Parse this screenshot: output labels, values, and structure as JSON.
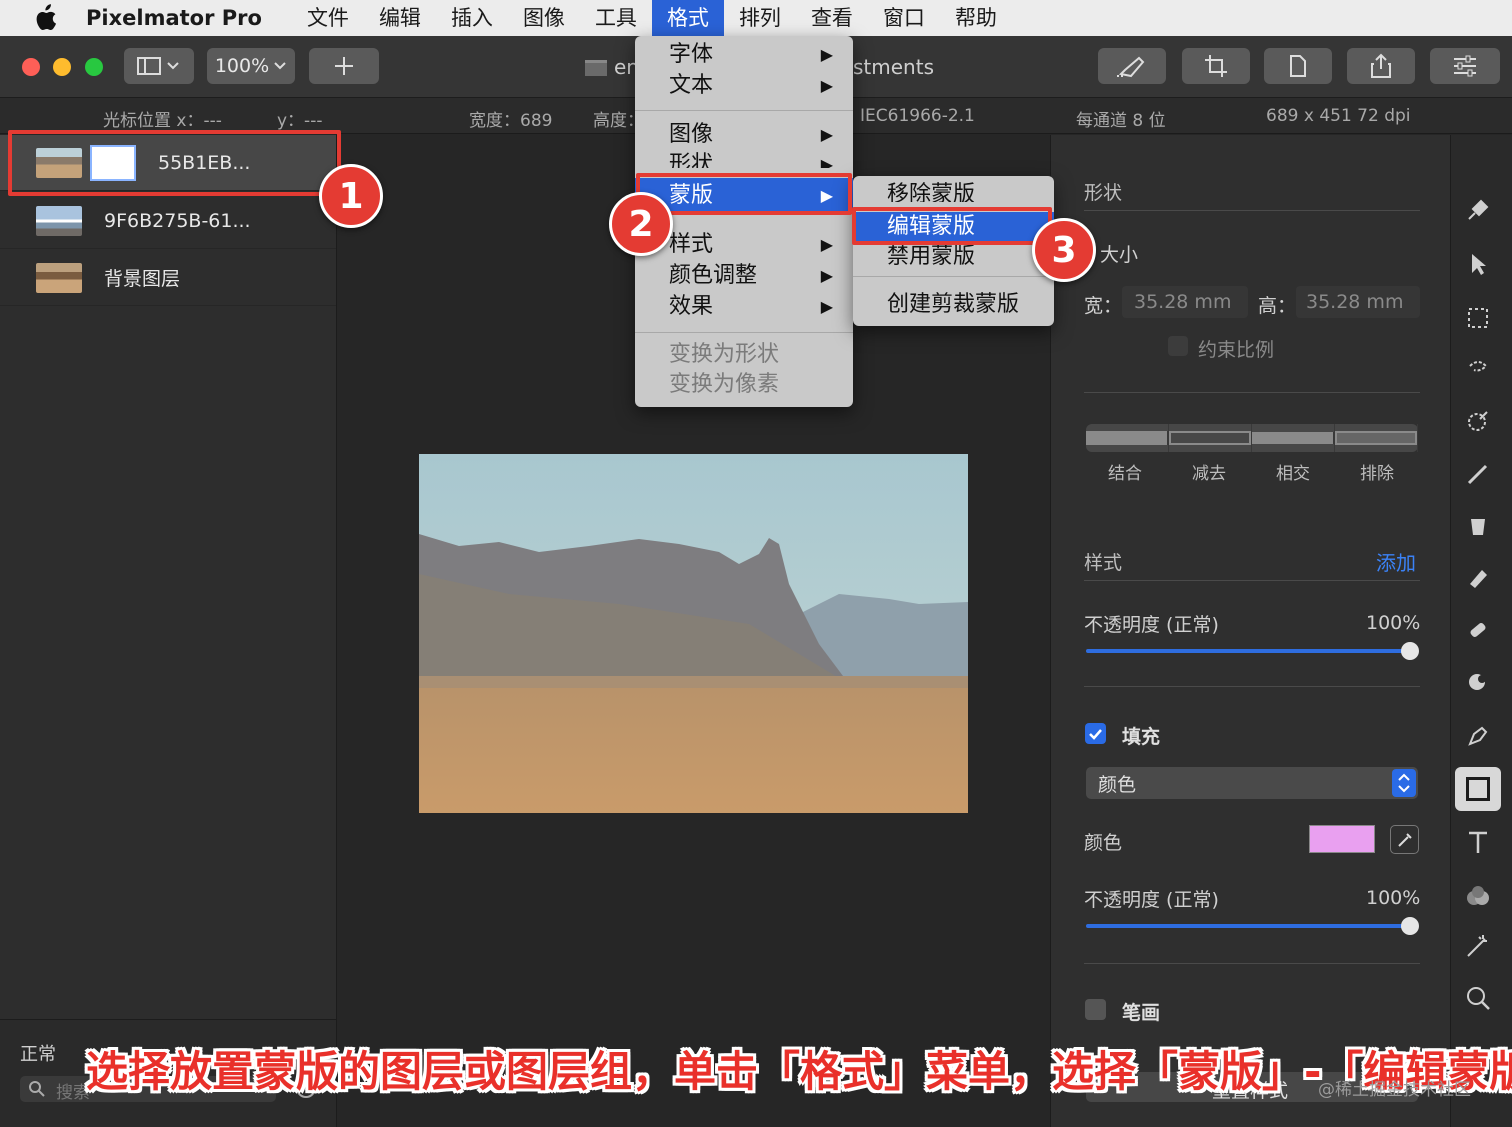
{
  "menubar": {
    "app_name": "Pixelmator Pro",
    "items": [
      "文件",
      "编辑",
      "插入",
      "图像",
      "工具",
      "格式",
      "排列",
      "查看",
      "窗口",
      "帮助"
    ],
    "active_index": 5
  },
  "toolbar": {
    "zoom": "100%",
    "doc_title_left": "en",
    "doc_title_right": "stments"
  },
  "infobar": {
    "cursor_x": "光标位置 x：---",
    "cursor_y": "y：---",
    "width": "宽度：689",
    "height": "高度：",
    "profile": "IEC61966-2.1",
    "depth": "每通道 8 位",
    "size": "689 x 451 72 dpi"
  },
  "layers": [
    {
      "name": "55B1EB...",
      "selected": true
    },
    {
      "name": "9F6B275B-61...",
      "selected": false
    },
    {
      "name": "背景图层",
      "selected": false
    }
  ],
  "layers_footer": {
    "blend_mode": "正常",
    "search_placeholder": "搜索"
  },
  "format_menu": {
    "items": [
      "字体",
      "文本",
      "图像",
      "形状",
      "蒙版",
      "样式",
      "颜色调整",
      "效果",
      "变换为形状",
      "变换为像素"
    ]
  },
  "mask_submenu": {
    "items": [
      "移除蒙版",
      "编辑蒙版",
      "禁用蒙版",
      "创建剪裁蒙版"
    ]
  },
  "inspector": {
    "shape_title": "形状",
    "size_label": "大小",
    "width_label": "宽：",
    "width_value": "35.28 mm",
    "height_label": "高：",
    "height_value": "35.28 mm",
    "constrain_label": "约束比例",
    "bool_ops": [
      "结合",
      "减去",
      "相交",
      "排除"
    ],
    "style_title": "样式",
    "add_label": "添加",
    "opacity_label": "不透明度 (正常)",
    "opacity_value": "100%",
    "fill_label": "填充",
    "fill_type": "颜色",
    "color_label": "颜色",
    "fill_color": "#e9a0f0",
    "opacity2_label": "不透明度 (正常)",
    "opacity2_value": "100%",
    "stroke_label": "笔画",
    "reset_label": "重置样式"
  },
  "annotations": {
    "badges": [
      "1",
      "2",
      "3"
    ],
    "caption": "选择放置蒙版的图层或图层组，单击「格式」菜单，选择「蒙版」-「编辑蒙版」",
    "watermark": "@稀土掘金技术社区"
  },
  "colors": {
    "accent": "#2a62d6",
    "annotation_red": "#e43b33"
  }
}
